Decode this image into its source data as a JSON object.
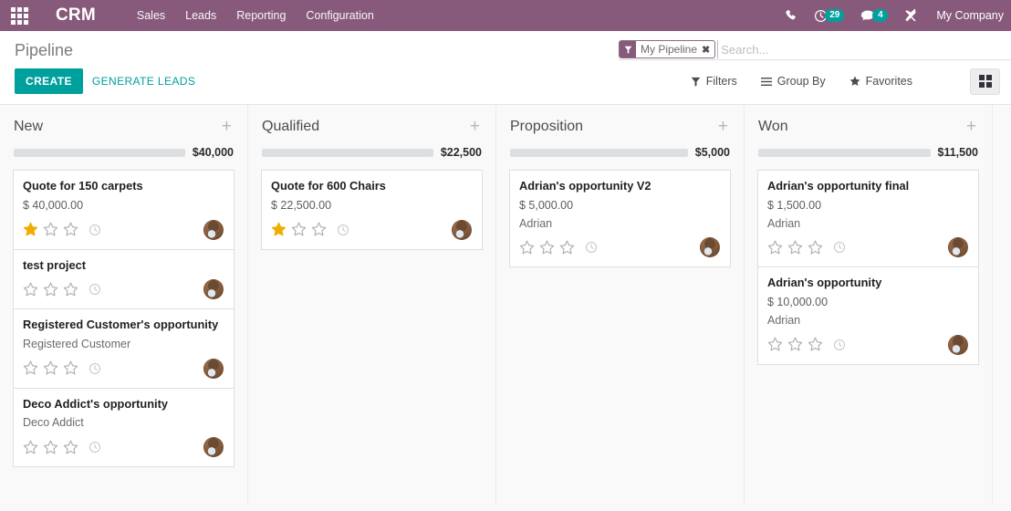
{
  "navbar": {
    "apps_icon": "apps-grid-icon",
    "brand": "CRM",
    "menu": [
      {
        "label": "Sales"
      },
      {
        "label": "Leads"
      },
      {
        "label": "Reporting"
      },
      {
        "label": "Configuration"
      }
    ],
    "phone_icon": "phone-icon",
    "activity_icon": "clock-icon",
    "activity_count": "29",
    "messages_icon": "chat-bubble-icon",
    "messages_count": "4",
    "tools_icon": "tools-icon",
    "company": "My Company",
    "bg_color": "#875A7B",
    "badge_color": "#00A09D"
  },
  "control_panel": {
    "breadcrumb": "Pipeline",
    "search": {
      "facet_icon": "filter-funnel-icon",
      "facet_label": "My Pipeline",
      "facet_close": "✖",
      "placeholder": "Search..."
    },
    "create_label": "CREATE",
    "generate_leads_label": "GENERATE LEADS",
    "filters_label": "Filters",
    "group_by_label": "Group By",
    "favorites_label": "Favorites",
    "filters_icon": "filter-funnel-icon",
    "group_by_icon": "hamburger-icon",
    "favorites_icon": "star-icon",
    "view_kanban_icon": "kanban-view-icon",
    "accent_color": "#00A09D"
  },
  "kanban": {
    "columns": [
      {
        "title": "New",
        "add_icon": "plus-icon",
        "amount": "$40,000",
        "progress_pct": 100,
        "cards": [
          {
            "title": "Quote for 150 carpets",
            "amount": "$ 40,000.00",
            "partner": "",
            "stars_filled": 1,
            "stars_total": 3,
            "clock_icon": "clock-icon",
            "avatar": "user-avatar"
          },
          {
            "title": "test project",
            "amount": "",
            "partner": "",
            "stars_filled": 0,
            "stars_total": 3,
            "clock_icon": "clock-icon",
            "avatar": "user-avatar"
          },
          {
            "title": "Registered Customer's opportunity",
            "amount": "",
            "partner": "Registered Customer",
            "stars_filled": 0,
            "stars_total": 3,
            "clock_icon": "clock-icon",
            "avatar": "user-avatar"
          },
          {
            "title": "Deco Addict's opportunity",
            "amount": "",
            "partner": "Deco Addict",
            "stars_filled": 0,
            "stars_total": 3,
            "clock_icon": "clock-icon",
            "avatar": "user-avatar"
          }
        ]
      },
      {
        "title": "Qualified",
        "add_icon": "plus-icon",
        "amount": "$22,500",
        "progress_pct": 100,
        "cards": [
          {
            "title": "Quote for 600 Chairs",
            "amount": "$ 22,500.00",
            "partner": "",
            "stars_filled": 1,
            "stars_total": 3,
            "clock_icon": "clock-icon",
            "avatar": "user-avatar"
          }
        ]
      },
      {
        "title": "Proposition",
        "add_icon": "plus-icon",
        "amount": "$5,000",
        "progress_pct": 100,
        "cards": [
          {
            "title": "Adrian's opportunity V2",
            "amount": "$ 5,000.00",
            "partner": "Adrian",
            "stars_filled": 0,
            "stars_total": 3,
            "clock_icon": "clock-icon",
            "avatar": "user-avatar"
          }
        ]
      },
      {
        "title": "Won",
        "add_icon": "plus-icon",
        "amount": "$11,500",
        "progress_pct": 100,
        "cards": [
          {
            "title": "Adrian's opportunity final",
            "amount": "$ 1,500.00",
            "partner": "Adrian",
            "stars_filled": 0,
            "stars_total": 3,
            "clock_icon": "clock-icon",
            "avatar": "user-avatar"
          },
          {
            "title": "Adrian's opportunity",
            "amount": "$ 10,000.00",
            "partner": "Adrian",
            "stars_filled": 0,
            "stars_total": 3,
            "clock_icon": "clock-icon",
            "avatar": "user-avatar"
          }
        ]
      }
    ]
  }
}
